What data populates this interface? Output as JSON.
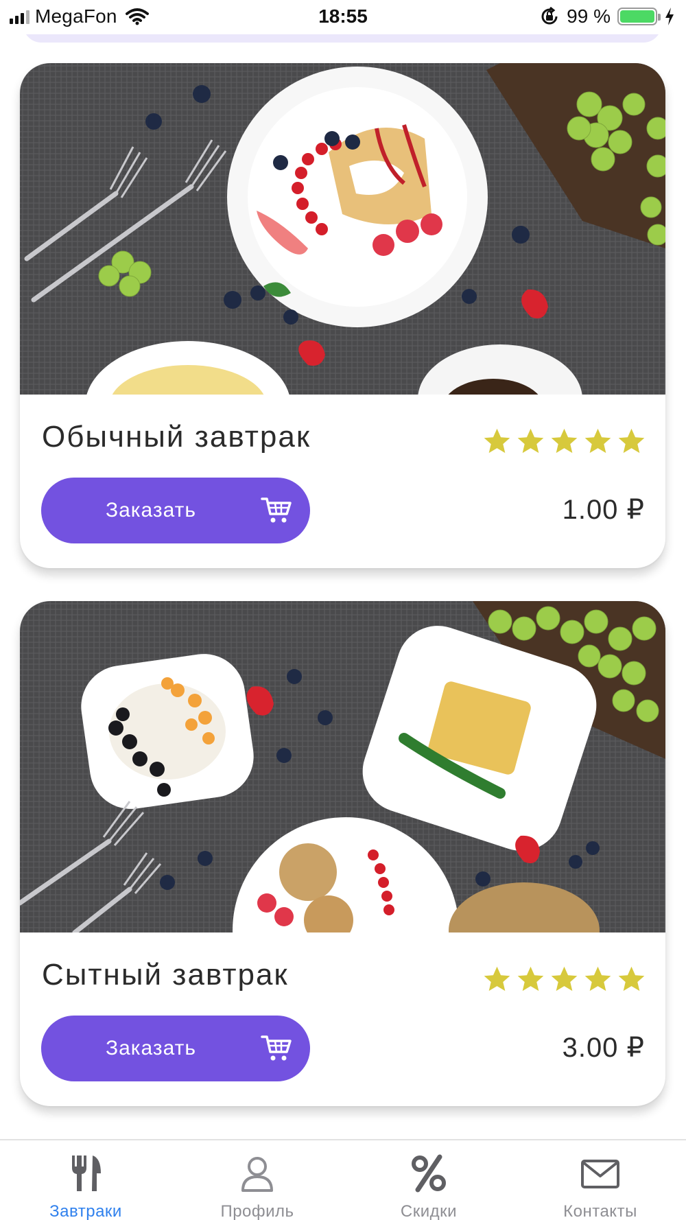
{
  "status_bar": {
    "carrier": "MegaFon",
    "time": "18:55",
    "battery_percent": "99 %",
    "battery_level": 0.99,
    "icons": [
      "signal-icon",
      "wifi-icon",
      "rotation-lock-icon",
      "battery-icon",
      "charging-icon"
    ]
  },
  "colors": {
    "accent": "#7352e0",
    "star": "#d7c93c",
    "tab_active": "#2f80ed",
    "tab_inactive": "#8e8e93",
    "battery": "#4cd964"
  },
  "breakfasts": [
    {
      "title": "Обычный завтрак",
      "rating": 5,
      "order_label": "Заказать",
      "price": "1.00 ₽"
    },
    {
      "title": "Сытный завтрак",
      "rating": 5,
      "order_label": "Заказать",
      "price": "3.00 ₽"
    }
  ],
  "tab_bar": {
    "active_index": 0,
    "tabs": [
      {
        "label": "Завтраки",
        "icon": "fork-knife-icon"
      },
      {
        "label": "Профиль",
        "icon": "user-icon"
      },
      {
        "label": "Скидки",
        "icon": "percent-icon"
      },
      {
        "label": "Контакты",
        "icon": "mail-icon"
      }
    ]
  }
}
